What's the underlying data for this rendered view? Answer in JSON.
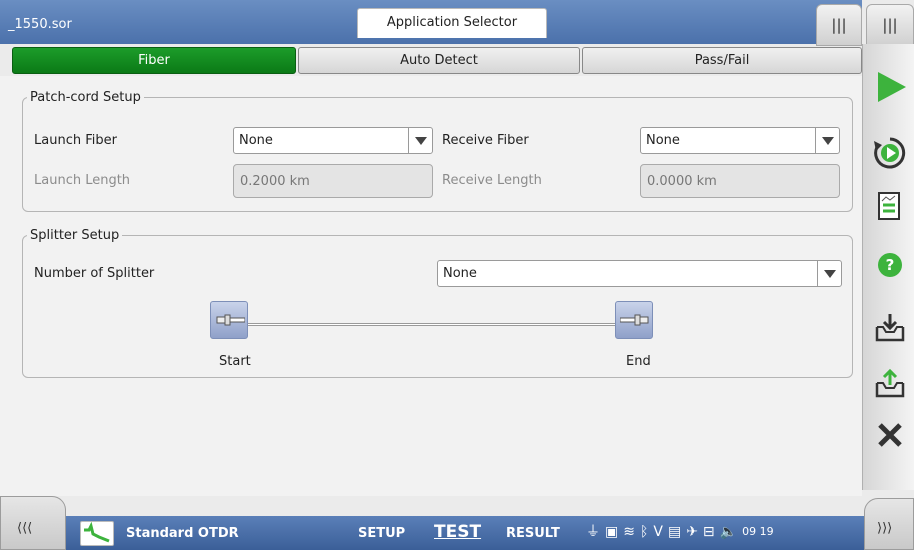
{
  "header": {
    "file_title": "_1550.sor",
    "app_selector_label": "Application Selector"
  },
  "tabs": [
    {
      "label": "Fiber",
      "active": true
    },
    {
      "label": "Auto Detect",
      "active": false
    },
    {
      "label": "Pass/Fail",
      "active": false
    }
  ],
  "patch_cord": {
    "legend": "Patch-cord Setup",
    "launch_fiber_label": "Launch Fiber",
    "launch_fiber_value": "None",
    "receive_fiber_label": "Receive Fiber",
    "receive_fiber_value": "None",
    "launch_length_label": "Launch Length",
    "launch_length_value": "0.2000 km",
    "receive_length_label": "Receive Length",
    "receive_length_value": "0.0000 km"
  },
  "splitter": {
    "legend": "Splitter Setup",
    "number_label": "Number of Splitter",
    "number_value": "None",
    "start_label": "Start",
    "end_label": "End"
  },
  "sidebar": {
    "icons": [
      "play-icon",
      "refresh-play-icon",
      "report-icon",
      "help-icon",
      "save-icon",
      "open-icon",
      "close-icon"
    ]
  },
  "bottom": {
    "left_chevron": "⟨⟨⟨",
    "right_chevron": "⟩⟩⟩",
    "app_name": "Standard OTDR",
    "setup_label": "SETUP",
    "test_label": "TEST",
    "result_label": "RESULT",
    "time": "09 19"
  },
  "corner_tabs": {
    "left": "|||",
    "right": "|||"
  },
  "colors": {
    "accent_blue": "#4b71ab",
    "active_tab_green": "#0b7a16",
    "play_green": "#3db33d"
  }
}
